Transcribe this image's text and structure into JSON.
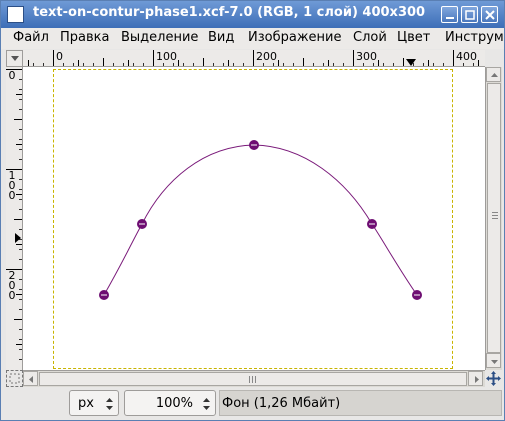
{
  "window": {
    "title": "text-on-contur-phase1.xcf-7.0 (RGB, 1 слой) 400x300",
    "titlebar_color": "#4a7cc4"
  },
  "menu": {
    "items": [
      "Файл",
      "Правка",
      "Выделение",
      "Вид",
      "Изображение",
      "Слой",
      "Цвет",
      "Инструм"
    ]
  },
  "rulers": {
    "horizontal_labels": [
      "0",
      "100",
      "200",
      "300",
      "400"
    ],
    "vertical_labels": [
      "0",
      "100",
      "200"
    ]
  },
  "canvas": {
    "width": 400,
    "height": 300,
    "path_color": "#7a1a7a",
    "guide_color": "#c8b400"
  },
  "statusbar": {
    "unit": "px",
    "zoom": "100%",
    "status": "Фон (1,26 Мбайт)"
  },
  "icons": [
    "window-menu-icon",
    "minimize-icon",
    "maximize-icon",
    "close-icon",
    "quick-mask-icon",
    "navigate-icon",
    "spin-arrows-icon"
  ]
}
